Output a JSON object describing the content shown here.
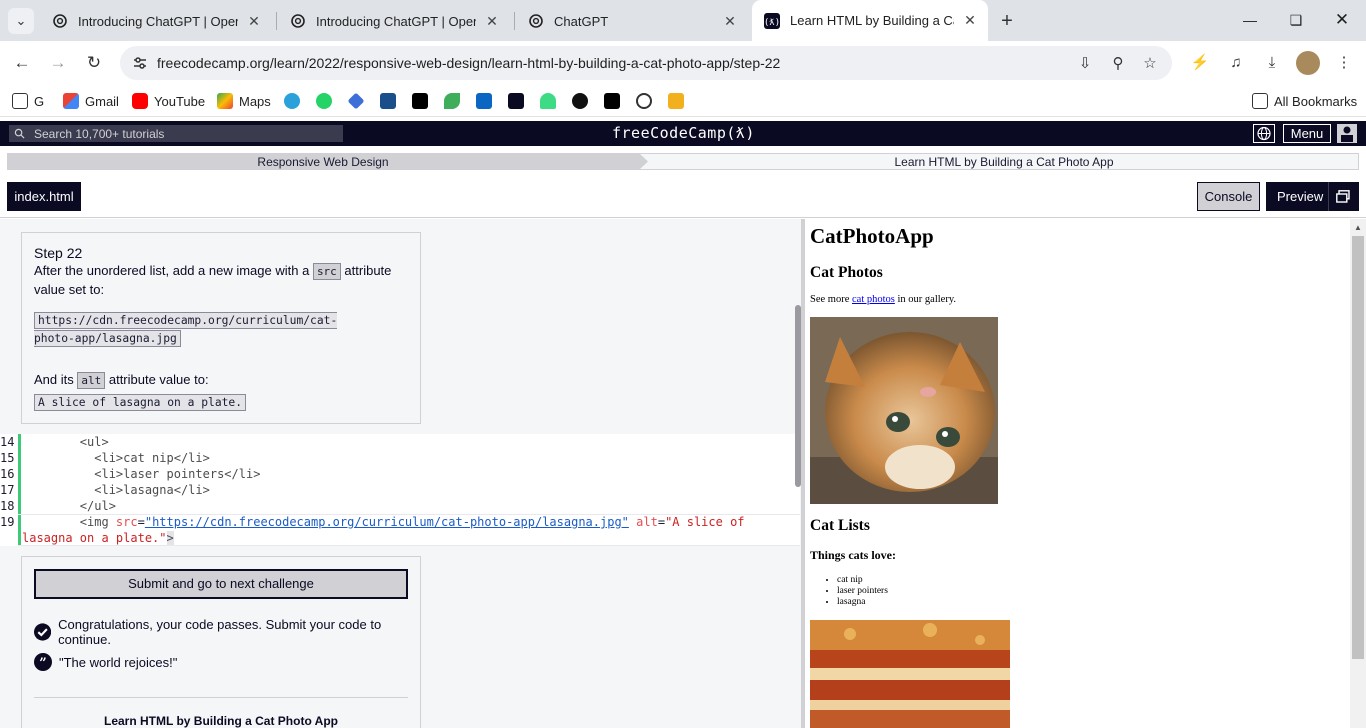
{
  "browser": {
    "tabs": [
      {
        "title": "Introducing ChatGPT | OpenAI"
      },
      {
        "title": "Introducing ChatGPT | OpenAI"
      },
      {
        "title": "ChatGPT"
      },
      {
        "title": "Learn HTML by Building a Cat Photo App"
      }
    ],
    "url": "freecodecamp.org/learn/2022/responsive-web-design/learn-html-by-building-a-cat-photo-app/step-22",
    "bookmarks": {
      "g": "G",
      "gmail": "Gmail",
      "youtube": "YouTube",
      "maps": "Maps",
      "all": "All Bookmarks"
    }
  },
  "fcc": {
    "search_placeholder": "Search 10,700+ tutorials",
    "logo": "freeCodeCamp(ƛ)",
    "menu_label": "Menu",
    "breadcrumb": {
      "superblock": "Responsive Web Design",
      "block": "Learn HTML by Building a Cat Photo App"
    },
    "file_tab": "index.html",
    "console_label": "Console",
    "preview_label": "Preview"
  },
  "instructions": {
    "title": "Step 22",
    "p1_before": "After the unordered list, add a new image with a ",
    "src_code": "src",
    "p1_after": " attribute value set to:",
    "url_code": "https://cdn.freecodecamp.org/curriculum/cat-photo-app/lasagna.jpg",
    "p2_before": "And its ",
    "alt_code": "alt",
    "p2_after": " attribute value to:",
    "alt_value": "A slice of lasagna on a plate."
  },
  "code": {
    "lines": [
      {
        "num": "14",
        "indent": "        ",
        "text": "<ul>"
      },
      {
        "num": "15",
        "indent": "          ",
        "text": "<li>cat nip</li>"
      },
      {
        "num": "16",
        "indent": "          ",
        "text": "<li>laser pointers</li>"
      },
      {
        "num": "17",
        "indent": "          ",
        "text": "<li>lasagna</li>"
      },
      {
        "num": "18",
        "indent": "        ",
        "text": "</ul>"
      }
    ],
    "line19": {
      "num": "19",
      "tag_open": "<img ",
      "attr_src": "src",
      "eq1": "=",
      "src_value": "\"https://cdn.freecodecamp.org/curriculum/cat-photo-app/lasagna.jpg\"",
      "attr_alt": "alt",
      "eq2": "=",
      "alt_value_start": "\"A slice of",
      "alt_value_end": "lasagna on a plate.\"",
      "tag_close": ">"
    }
  },
  "results": {
    "submit_label": "Submit and go to next challenge",
    "pass_message": "Congratulations, your code passes. Submit your code to continue.",
    "quote": "\"The world rejoices!\"",
    "course_title": "Learn HTML by Building a Cat Photo App"
  },
  "preview": {
    "h1": "CatPhotoApp",
    "h2_photos": "Cat Photos",
    "p_before": "See more ",
    "p_link": "cat photos",
    "p_after": " in our gallery.",
    "h2_lists": "Cat Lists",
    "h3": "Things cats love:",
    "list": [
      "cat nip",
      "laser pointers",
      "lasagna"
    ]
  },
  "colors": {
    "fcc_dark": "#0a0a23",
    "fcc_gray": "#d0d0d5",
    "pass_green": "#3ec979"
  }
}
